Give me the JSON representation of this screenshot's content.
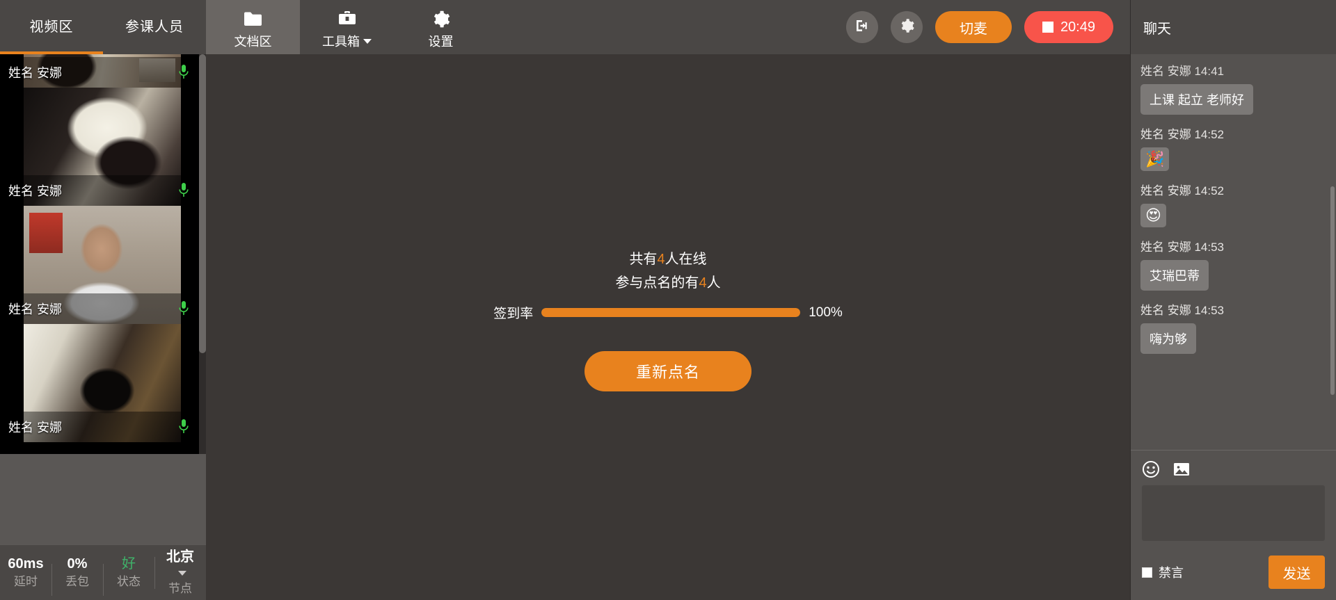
{
  "left_panel": {
    "tabs": [
      {
        "label": "视频区",
        "active": true
      },
      {
        "label": "参课人员",
        "active": false
      }
    ],
    "participants": [
      {
        "name": "姓名 安娜",
        "mic": "mic-icon",
        "mic_state": "on"
      },
      {
        "name": "姓名 安娜",
        "mic": "mic-icon",
        "mic_state": "on"
      },
      {
        "name": "姓名 安娜",
        "mic": "mic-icon",
        "mic_state": "on"
      },
      {
        "name": "姓名 安娜",
        "mic": "mic-icon",
        "mic_state": "on"
      }
    ],
    "status_bar": [
      {
        "value": "60ms",
        "label": "延时",
        "kind": "plain"
      },
      {
        "value": "0%",
        "label": "丢包",
        "kind": "plain"
      },
      {
        "value": "好",
        "label": "状态",
        "kind": "good"
      },
      {
        "value": "北京",
        "label": "节点",
        "kind": "dropdown"
      }
    ]
  },
  "toolbar": {
    "items": [
      {
        "label": "文档区",
        "icon": "folder-icon",
        "active": true,
        "caret": false
      },
      {
        "label": "工具箱",
        "icon": "toolbox-icon",
        "active": false,
        "caret": true
      },
      {
        "label": "设置",
        "icon": "gear-icon",
        "active": false,
        "caret": false
      }
    ],
    "exit_icon": "exit-icon",
    "settings_icon": "gear-icon",
    "mic_toggle_label": "切麦",
    "timer_label": "20:49",
    "timer_icon": "stop-square-icon"
  },
  "roll_call": {
    "online_prefix": "共有",
    "online_count": "4",
    "online_suffix": "人在线",
    "joined_prefix": "参与点名的有",
    "joined_count": "4",
    "joined_suffix": "人",
    "rate_label": "签到率",
    "rate_percent": "100%",
    "rate_value": 100,
    "restart_label": "重新点名"
  },
  "chat": {
    "title": "聊天",
    "messages": [
      {
        "meta": "姓名 安娜 14:41",
        "text": "上课 起立 老师好",
        "type": "text",
        "clipped": true
      },
      {
        "meta": "姓名 安娜 14:52",
        "text": "🎉",
        "type": "emoji"
      },
      {
        "meta": "姓名 安娜 14:52",
        "text": "😍",
        "type": "emoji"
      },
      {
        "meta": "姓名 安娜 14:53",
        "text": "艾瑞巴蒂",
        "type": "text"
      },
      {
        "meta": "姓名 安娜 14:53",
        "text": "嗨为够",
        "type": "text"
      }
    ],
    "compose": {
      "emoji_icon": "smiley-icon",
      "image_icon": "image-icon",
      "input_value": "",
      "input_placeholder": "",
      "mute_all_label": "禁言",
      "mute_all_checked": false,
      "send_label": "发送"
    }
  },
  "colors": {
    "accent_orange": "#e8821e",
    "danger_red": "#f8544a",
    "status_good_green": "#3fb36a",
    "panel_dark": "#3b3735",
    "panel_mid": "#4a4745",
    "chat_panel": "#555250"
  }
}
